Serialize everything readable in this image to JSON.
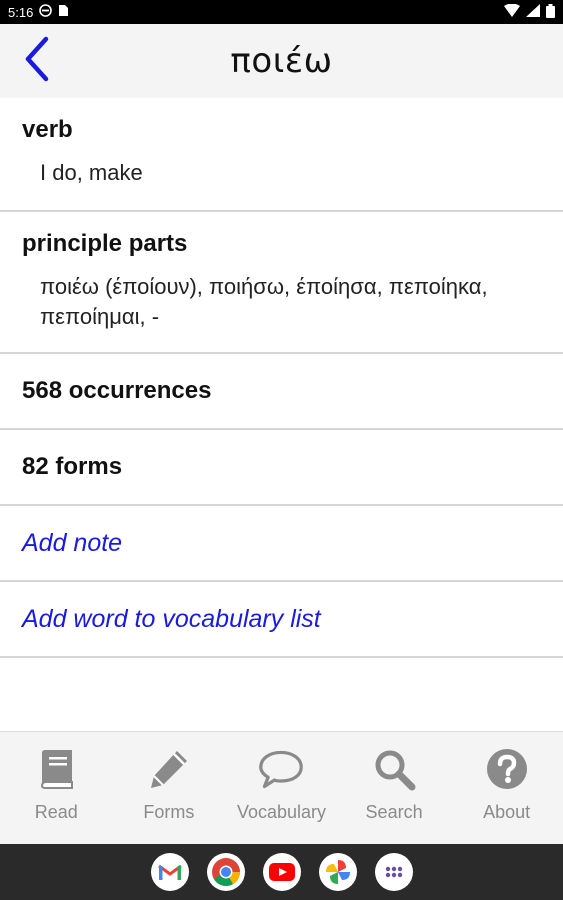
{
  "status_bar": {
    "time": "5:16",
    "icons": [
      "vpn-icon",
      "sim-card-icon",
      "wifi-icon",
      "signal-icon",
      "battery-icon"
    ]
  },
  "header": {
    "title": "ποιέω",
    "back_icon": "chevron-left-icon"
  },
  "sections": {
    "verb": {
      "heading": "verb",
      "body": "I do, make"
    },
    "principal_parts": {
      "heading": "principle parts",
      "line1": "ποιέω (έποίουν), ποιήσω, έποίησα, πεποίηκα,",
      "line2": "πεποίημαι, -"
    },
    "occurrences": "568 occurrences",
    "forms": "82 forms",
    "add_note": "Add note",
    "add_vocab": "Add word to vocabulary list"
  },
  "bottom_nav": {
    "items": [
      {
        "label": "Read",
        "icon": "book-icon"
      },
      {
        "label": "Forms",
        "icon": "pencil-icon"
      },
      {
        "label": "Vocabulary",
        "icon": "speech-bubble-icon"
      },
      {
        "label": "Search",
        "icon": "magnifier-icon"
      },
      {
        "label": "About",
        "icon": "help-circle-icon"
      }
    ]
  },
  "dock": {
    "apps": [
      "gmail-icon",
      "chrome-icon",
      "youtube-icon",
      "photos-icon",
      "app-drawer-icon"
    ]
  },
  "colors": {
    "link": "#1a1ae0",
    "nav_icon": "#8a8a8a",
    "header_bg": "#f4f4f4",
    "divider": "#d6d6d6"
  }
}
